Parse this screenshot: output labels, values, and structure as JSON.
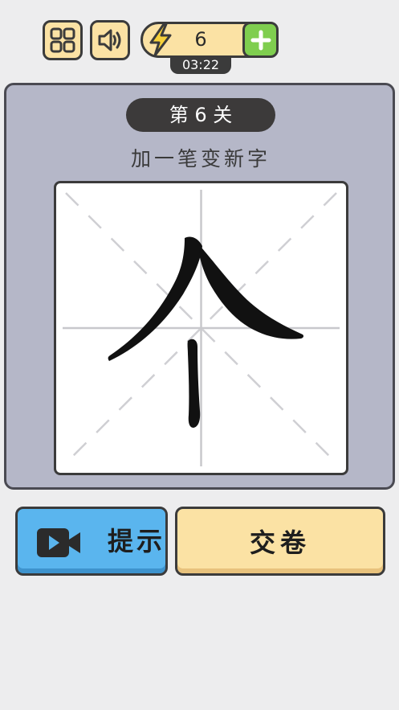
{
  "header": {
    "menu_icon": "grid-icon",
    "sound_icon": "speaker-icon",
    "energy": {
      "icon": "lightning-icon",
      "count": "6",
      "add_icon": "plus-icon"
    },
    "timer": "03:22"
  },
  "level": {
    "title": "第 6 关",
    "instruction": "加一笔变新字",
    "character": "个"
  },
  "actions": {
    "hint_label": "提示",
    "hint_icon": "video-camera-icon",
    "submit_label": "交卷"
  },
  "colors": {
    "background": "#ededee",
    "panel": "#b5b7c8",
    "button_yellow": "#fbe2a4",
    "button_blue": "#5ab5ee",
    "plus_green": "#7fce4f",
    "grid_lines": "#c8c8cc"
  }
}
